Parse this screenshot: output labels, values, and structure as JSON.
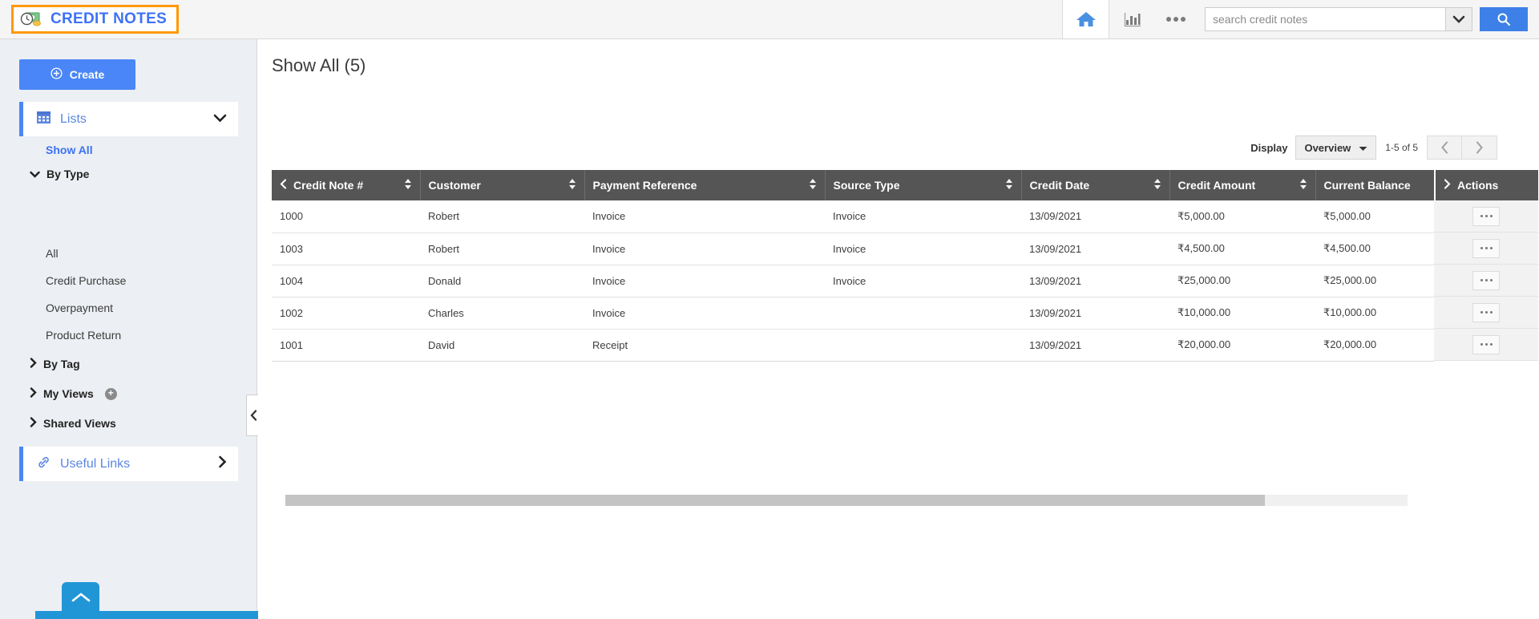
{
  "app": {
    "logo_text": "CREDIT NOTES",
    "logo_icon": "clock-money-icon"
  },
  "topbar": {
    "home_icon": "home-icon",
    "reports_icon": "bar-chart-icon",
    "more_icon": "ellipsis-icon",
    "search_placeholder": "search credit notes",
    "search_value": "",
    "search_dropdown_icon": "chevron-down-icon",
    "search_button_icon": "search-icon",
    "accent_blue": "#3d80e8"
  },
  "sidebar": {
    "create_label": "Create",
    "create_icon": "plus-circle-icon",
    "lists": {
      "label": "Lists",
      "icon": "grid-calendar-icon",
      "chevron": "chevron-down-icon"
    },
    "show_all_label": "Show All",
    "by_type": {
      "label": "By Type",
      "chevron": "chevron-down-icon",
      "items": [
        {
          "label": "All"
        },
        {
          "label": "Credit Purchase"
        },
        {
          "label": "Overpayment"
        },
        {
          "label": "Product Return"
        }
      ]
    },
    "by_tag": {
      "label": "By Tag",
      "chevron": "chevron-right-icon"
    },
    "my_views": {
      "label": "My Views",
      "chevron": "chevron-right-icon",
      "add_icon": "plus-circle-icon"
    },
    "shared_views": {
      "label": "Shared Views",
      "chevron": "chevron-right-icon"
    },
    "useful_links": {
      "label": "Useful Links",
      "icon": "link-chain-icon",
      "chevron": "chevron-right-icon"
    },
    "collapse_icon": "chevron-left-icon",
    "scroll_top_icon": "chevron-up-icon"
  },
  "main": {
    "page_title": "Show All (5)",
    "toolbar": {
      "display_label": "Display",
      "view_mode": "Overview",
      "view_mode_icon": "caret-down-icon",
      "range_text": "1-5 of 5",
      "prev_icon": "chevron-left-icon",
      "next_icon": "chevron-right-icon"
    },
    "table": {
      "lead_icon": "chevron-left-icon",
      "sort_icon": "sort-updown-icon",
      "columns": [
        {
          "label": "Credit Note #",
          "sortable": true
        },
        {
          "label": "Customer",
          "sortable": true
        },
        {
          "label": "Payment Reference",
          "sortable": true
        },
        {
          "label": "Source Type",
          "sortable": true
        },
        {
          "label": "Credit Date",
          "sortable": true
        },
        {
          "label": "Credit Amount",
          "sortable": true
        },
        {
          "label": "Current Balance",
          "sortable": false
        }
      ],
      "actions_header": "Actions",
      "actions_header_icon": "chevron-right-icon",
      "row_action_icon": "ellipsis-icon",
      "rows": [
        {
          "credit_note": "1000",
          "customer": "Robert",
          "payment_reference": "Invoice",
          "source_type": "Invoice",
          "credit_date": "13/09/2021",
          "credit_amount": "₹5,000.00",
          "current_balance": "₹5,000.00"
        },
        {
          "credit_note": "1003",
          "customer": "Robert",
          "payment_reference": "Invoice",
          "source_type": "Invoice",
          "credit_date": "13/09/2021",
          "credit_amount": "₹4,500.00",
          "current_balance": "₹4,500.00"
        },
        {
          "credit_note": "1004",
          "customer": "Donald",
          "payment_reference": "Invoice",
          "source_type": "Invoice",
          "credit_date": "13/09/2021",
          "credit_amount": "₹25,000.00",
          "current_balance": "₹25,000.00"
        },
        {
          "credit_note": "1002",
          "customer": "Charles",
          "payment_reference": "Invoice",
          "source_type": "",
          "credit_date": "13/09/2021",
          "credit_amount": "₹10,000.00",
          "current_balance": "₹10,000.00"
        },
        {
          "credit_note": "1001",
          "customer": "David",
          "payment_reference": "Receipt",
          "source_type": "",
          "credit_date": "13/09/2021",
          "credit_amount": "₹20,000.00",
          "current_balance": "₹20,000.00"
        }
      ]
    }
  }
}
